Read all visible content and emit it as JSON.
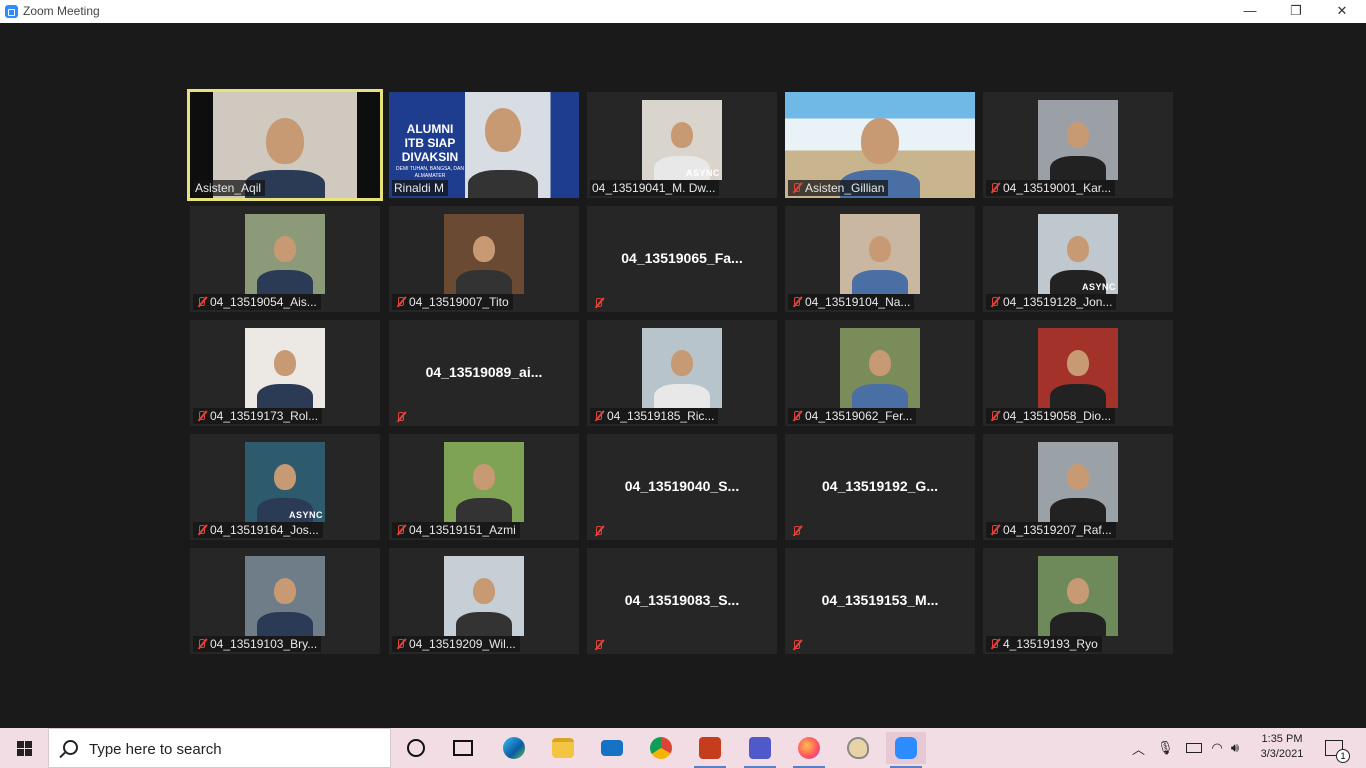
{
  "window": {
    "title": "Zoom Meeting",
    "minimize_glyph": "—",
    "restore_glyph": "❐",
    "close_glyph": "✕"
  },
  "participants": [
    {
      "name": "Asisten_Aqil",
      "muted": false,
      "active": true,
      "video": "room"
    },
    {
      "name": "Rinaldi M",
      "muted": false,
      "video": "banner",
      "banner_lines": [
        "ALUMNI",
        "ITB SIAP",
        "DIVAKSIN"
      ],
      "banner_sub": "DEMI TUHAN, BANGSA, DAN ALMAMATER"
    },
    {
      "name": "04_13519041_M. Dw...",
      "muted": false,
      "video": "person",
      "async": "ASYNC"
    },
    {
      "name": "Asisten_Gillian",
      "muted": true,
      "video": "beach"
    },
    {
      "name": "04_13519001_Kar...",
      "muted": true,
      "video": "person"
    },
    {
      "name": "04_13519054_Ais...",
      "muted": true,
      "video": "person"
    },
    {
      "name": "04_13519007_Tito",
      "muted": true,
      "video": "person"
    },
    {
      "name": "04_13519065_Fa...",
      "muted": true,
      "video": "none"
    },
    {
      "name": "04_13519104_Na...",
      "muted": true,
      "video": "person"
    },
    {
      "name": "04_13519128_Jon...",
      "muted": true,
      "video": "person",
      "async": "ASYNC"
    },
    {
      "name": "04_13519173_Rol...",
      "muted": true,
      "video": "person"
    },
    {
      "name": "04_13519089_ai...",
      "muted": true,
      "video": "none"
    },
    {
      "name": "04_13519185_Ric...",
      "muted": true,
      "video": "person"
    },
    {
      "name": "04_13519062_Fer...",
      "muted": true,
      "video": "person"
    },
    {
      "name": "04_13519058_Dio...",
      "muted": true,
      "video": "person"
    },
    {
      "name": "04_13519164_Jos...",
      "muted": true,
      "video": "person",
      "async": "ASYNC"
    },
    {
      "name": "04_13519151_Azmi",
      "muted": true,
      "video": "person"
    },
    {
      "name": "04_13519040_S...",
      "muted": true,
      "video": "none"
    },
    {
      "name": "04_13519192_G...",
      "muted": true,
      "video": "none"
    },
    {
      "name": "04_13519207_Raf...",
      "muted": true,
      "video": "person"
    },
    {
      "name": "04_13519103_Bry...",
      "muted": true,
      "video": "person"
    },
    {
      "name": "04_13519209_Wil...",
      "muted": true,
      "video": "person"
    },
    {
      "name": "04_13519083_S...",
      "muted": true,
      "video": "none"
    },
    {
      "name": "04_13519153_M...",
      "muted": true,
      "video": "none"
    },
    {
      "name": "4_13519193_Ryo",
      "muted": true,
      "video": "person"
    }
  ],
  "colors": {
    "video_bgs": [
      "#cfc9c0",
      "#1e3d8f",
      "#d9d4cc",
      "#8fd0e8",
      "#9aa0a6",
      "#8c9a7a",
      "#6a4a32",
      "#262626",
      "#c9b7a1",
      "#bfc7cf",
      "#ece9e4",
      "#262626",
      "#b8c4cc",
      "#7a8c5a",
      "#a3322a",
      "#2e5a6e",
      "#7ea354",
      "#262626",
      "#262626",
      "#9aa2a8",
      "#6f7d88",
      "#c7cfd6",
      "#262626",
      "#262626",
      "#6f8a5a"
    ],
    "skin": "#c79a74",
    "active_border": "#e6e37d",
    "muted_icon": "#e0433b",
    "taskbar": "#f3dde4"
  },
  "taskbar": {
    "search_placeholder": "Type here to search",
    "apps": [
      "task-view-icon",
      "cortana-icon",
      "edge-icon",
      "file-explorer-icon",
      "mail-icon",
      "chrome-icon",
      "powerpoint-icon",
      "teams-icon",
      "firefox-icon",
      "paint-icon",
      "zoom-icon"
    ],
    "time": "1:35 PM",
    "date": "3/3/2021",
    "notification_count": "1"
  }
}
